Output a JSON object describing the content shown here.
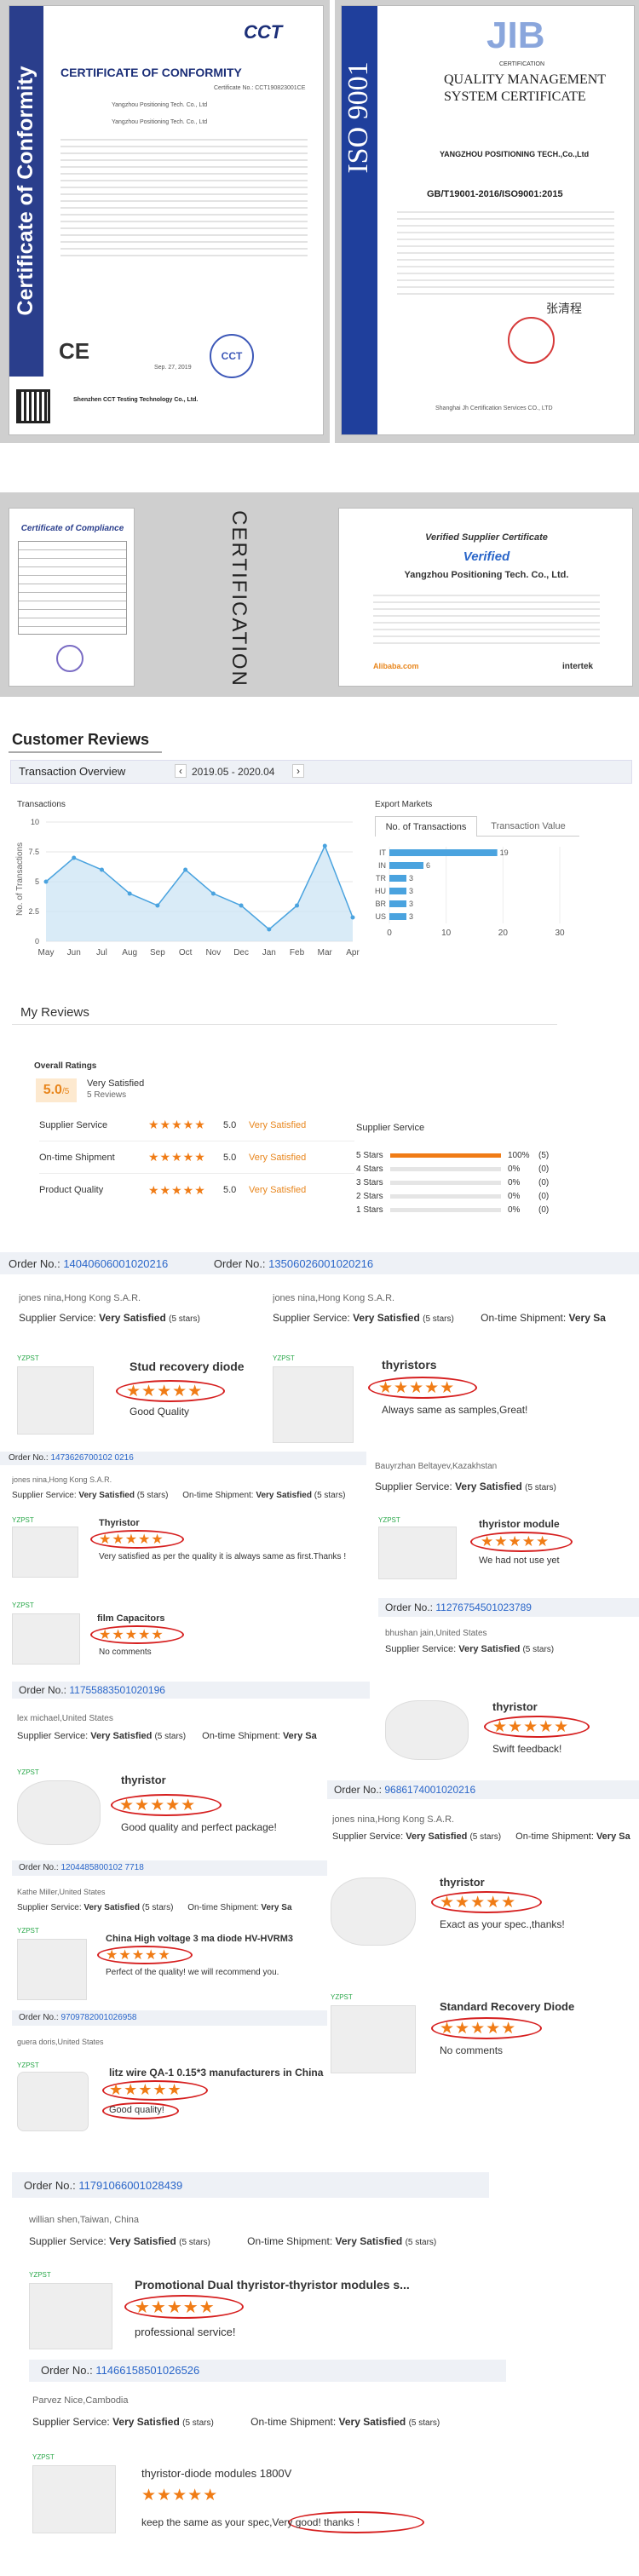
{
  "colors": {
    "accent": "#f07c16",
    "link": "#2a66c9",
    "iso_blue": "#1f3f9c",
    "cert_blue": "#2a3e8c",
    "chart_blue": "#4aa3df"
  },
  "cert1": {
    "side": "Certificate of Conformity",
    "title": "CERTIFICATE OF CONFORMITY",
    "logo": "CCT",
    "cert_no": "Certificate No.: CCT190823001CE",
    "applicant": "Yangzhou Positioning Tech. Co., Ltd",
    "manufacturer": "Yangzhou Positioning Tech. Co., Ltd",
    "lab": "Shenzhen CCT Testing Technology Co., Ltd.",
    "stamp": "CCT",
    "date": "Sep. 27, 2019"
  },
  "cert2": {
    "logo": "JIB",
    "sub": "CERTIFICATION",
    "title1": "QUALITY MANAGEMENT",
    "title2": "SYSTEM CERTIFICATE",
    "company": "YANGZHOU POSITIONING TECH.,Co.,Ltd",
    "std": "GB/T19001-2016/ISO9001:2015",
    "side": "ISO 9001",
    "issuer": "Shanghai Jh Certification Services CO., LTD",
    "sign": "张清程"
  },
  "cert3": {
    "title": "Certificate of Compliance",
    "side": "CERTIFICATION"
  },
  "cert4": {
    "title": "Verified Supplier Certificate",
    "verified": "Verified",
    "company": "Yangzhou Positioning Tech. Co., Ltd.",
    "logo1": "Alibaba.com",
    "logo2": "intertek"
  },
  "reviews_title": "Customer Reviews",
  "overview": {
    "tab": "Transaction Overview",
    "range": "2019.05 - 2020.04",
    "prev": "‹",
    "next": "›",
    "left_title": "Transactions",
    "right_title": "Export Markets",
    "tab_a": "No. of Transactions",
    "tab_b": "Transaction Value"
  },
  "chart_data": [
    {
      "type": "line",
      "title": "Transactions",
      "ylabel": "No. of Transactions",
      "categories": [
        "May",
        "Jun",
        "Jul",
        "Aug",
        "Sep",
        "Oct",
        "Nov",
        "Dec",
        "Jan",
        "Feb",
        "Mar",
        "Apr"
      ],
      "values": [
        5,
        7,
        6,
        4,
        3,
        6,
        4,
        3,
        1,
        3,
        8,
        2
      ],
      "ylim": [
        0,
        10
      ],
      "yticks": [
        0,
        2.5,
        5,
        7.5,
        10
      ]
    },
    {
      "type": "bar",
      "title": "Export Markets",
      "categories": [
        "IT",
        "IN",
        "TR",
        "HU",
        "BR",
        "US"
      ],
      "values": [
        19,
        6,
        3,
        3,
        3,
        3
      ],
      "xlim": [
        0,
        30
      ],
      "xticks": [
        0,
        10,
        20,
        30
      ]
    }
  ],
  "my_reviews": {
    "title": "My Reviews",
    "overall": "Overall Ratings",
    "score": "5.0",
    "den": "/5",
    "label": "Very Satisfied",
    "count": "5 Reviews",
    "cats": [
      {
        "name": "Supplier Service",
        "score": "5.0",
        "label": "Very Satisfied"
      },
      {
        "name": "On-time Shipment",
        "score": "5.0",
        "label": "Very Satisfied"
      },
      {
        "name": "Product Quality",
        "score": "5.0",
        "label": "Very Satisfied"
      }
    ],
    "svc_title": "Supplier Service",
    "dist": [
      {
        "label": "5 Stars",
        "pct": "100%",
        "n": "(5)",
        "f": 1
      },
      {
        "label": "4 Stars",
        "pct": "0%",
        "n": "(0)",
        "f": 0
      },
      {
        "label": "3 Stars",
        "pct": "0%",
        "n": "(0)",
        "f": 0
      },
      {
        "label": "2 Stars",
        "pct": "0%",
        "n": "(0)",
        "f": 0
      },
      {
        "label": "1 Stars",
        "pct": "0%",
        "n": "(0)",
        "f": 0
      }
    ]
  },
  "stars": "★★★★★",
  "yz": "YZPST",
  "lbl": {
    "order": "Order No.:",
    "ss": "Supplier Service:",
    "os": "On-time Shipment:",
    "vs": "Very Satisfied",
    "vsy": "Very Sa",
    "five": "(5 stars)"
  },
  "o1": {
    "a": "14040606001020216",
    "b": "13506026001020216",
    "buyer": "jones nina,Hong Kong S.A.R."
  },
  "p1": {
    "title": "Stud recovery diode",
    "text": "Good Quality"
  },
  "p2": {
    "title": "thyristors",
    "text": "Always same as samples,Great!"
  },
  "o2": {
    "no": "1473626700102 0216",
    "buyer": "jones nina,Hong Kong S.A.R.",
    "buyer2": "Bauyrzhan Beltayev,Kazakhstan"
  },
  "p3": {
    "title": "Thyristor",
    "text": "Very satisfied as per the quality it is always same as first.Thanks !"
  },
  "p4": {
    "title": "thyristor module",
    "text": "We had not use yet"
  },
  "o3": {
    "no": "11276754501023789",
    "buyer": "bhushan jain,United States"
  },
  "p5": {
    "title": "film Capacitors",
    "text": "No comments"
  },
  "o4": {
    "no": "11755883501020196",
    "buyer": "lex michael,United States"
  },
  "p6": {
    "title": "thyristor",
    "text": "Swift feedback!"
  },
  "p7": {
    "title": "thyristor",
    "text": "Good quality and perfect package!"
  },
  "o5": {
    "no": "9686174001020216",
    "buyer": "jones nina,Hong Kong S.A.R."
  },
  "o6": {
    "no": "1204485800102 7718",
    "buyer": "Kathe Miller,United States"
  },
  "p8": {
    "title": "thyristor",
    "text": "Exact as your spec.,thanks!"
  },
  "p9": {
    "title": "China High voltage 3 ma diode HV-HVRM3",
    "text": "Perfect of the quality! we will recommend you."
  },
  "o7": {
    "no": "9709782001026958",
    "buyer": "guera doris,United States"
  },
  "p10": {
    "title": "Standard Recovery Diode",
    "text": "No comments"
  },
  "p11": {
    "title": "litz wire QA-1 0.15*3 manufacturers in China",
    "text": "Good quality!"
  },
  "o8": {
    "no": "11791066001028439",
    "buyer": "willian shen,Taiwan, China"
  },
  "p12": {
    "title": "Promotional Dual thyristor-thyristor modules s...",
    "text": "professional service!"
  },
  "o9": {
    "no": "11466158501026526",
    "buyer": "Parvez Nice,Cambodia"
  },
  "p13": {
    "title": "thyristor-diode modules 1800V",
    "text": "keep the same as your spec,Very good! thanks !"
  }
}
